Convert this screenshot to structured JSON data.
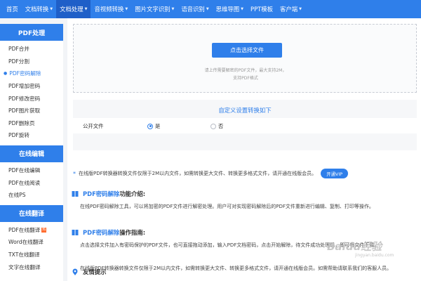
{
  "topnav": {
    "items": [
      {
        "label": "首页",
        "has_caret": false
      },
      {
        "label": "文档转换",
        "has_caret": true
      },
      {
        "label": "文档处理",
        "has_caret": true,
        "active": true
      },
      {
        "label": "音视频转换",
        "has_caret": true
      },
      {
        "label": "图片文字识别",
        "has_caret": true
      },
      {
        "label": "语音识别",
        "has_caret": true
      },
      {
        "label": "思维导图",
        "has_caret": true
      },
      {
        "label": "PPT模板",
        "has_caret": false
      },
      {
        "label": "客户端",
        "has_caret": true
      }
    ],
    "accent_color": "#2f7fea"
  },
  "sidebar": {
    "sections": [
      {
        "title": "PDF处理",
        "items": [
          "PDF合并",
          "PDF分割",
          "PDF密码解除",
          "PDF增加密码",
          "PDF修改密码",
          "PDF图片获取",
          "PDF删除页",
          "PDF旋转"
        ],
        "active_item": "PDF密码解除"
      },
      {
        "title": "在线编辑",
        "items": [
          "PDF在线编辑",
          "PDF在线阅读",
          "在线PS"
        ]
      },
      {
        "title": "在线翻译",
        "items": [
          "PDF在线翻译",
          "Word在线翻译",
          "TXT在线翻译",
          "文字在线翻译"
        ],
        "hot_item": "PDF在线翻译"
      }
    ]
  },
  "upload": {
    "button_label": "点击选择文件",
    "tip_line1": "请上传需要解密的PDF文件，最大支持2M，",
    "tip_line2": "支持PDF格式"
  },
  "settings": {
    "title": "自定义设置转换如下",
    "row_label": "公开文件",
    "options": [
      {
        "label": "是",
        "checked": true
      },
      {
        "label": "否",
        "checked": false
      }
    ]
  },
  "notice": {
    "text": "在线版PDF转换器转换文件仅限于2M以内文件，如需转换更大文件、转换更多格式文件，请开通在线版会员。",
    "vip_button": "开通VIP"
  },
  "intro": {
    "title_blue": "PDF密码解除",
    "title_rest": " 功能介绍:",
    "text": "在线PDF密码解除工具，可以将加密的PDF文件进行解密处理。用户可对实现密码解除后的PDF文件重新进行编辑、复制、打印等操作。"
  },
  "guide": {
    "title_blue": "PDF密码解除",
    "title_rest": " 操作指南:",
    "text": "点击选择文件加入有密码保护的PDF文件，也可直接拖动添加，输入PDF文档密码，点击开始解除，待文件成功处理后，即可将文件下载。"
  },
  "tips": {
    "title": "友情提示",
    "text": "在线版PDF转换器转换文件仅限于2M以内文件，如需转换更大文件、转换更多格式文件，请开通在线版会员。如需帮助请联系我们的客服人员。"
  },
  "watermark": {
    "text": "Baidu经验",
    "sub": "jingyan.baidu.com"
  }
}
